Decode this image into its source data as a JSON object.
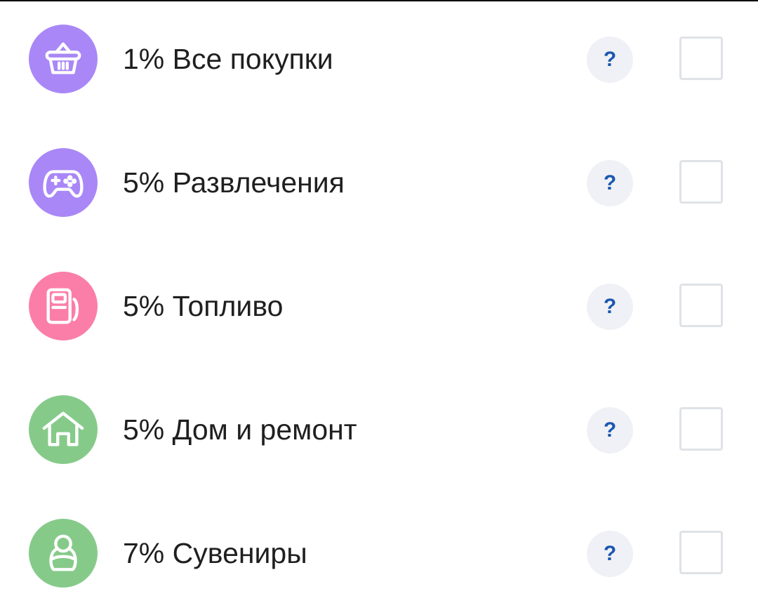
{
  "categories": [
    {
      "label": "1% Все покупки",
      "icon": "shopping-basket-icon",
      "color": "#a987f7",
      "help": "?",
      "checked": false
    },
    {
      "label": "5% Развлечения",
      "icon": "gamepad-icon",
      "color": "#a987f7",
      "help": "?",
      "checked": false
    },
    {
      "label": "5% Топливо",
      "icon": "fuel-pump-icon",
      "color": "#fb7ea8",
      "help": "?",
      "checked": false
    },
    {
      "label": "5% Дом и ремонт",
      "icon": "house-icon",
      "color": "#86ca8a",
      "help": "?",
      "checked": false
    },
    {
      "label": "7% Сувениры",
      "icon": "matryoshka-icon",
      "color": "#86ca8a",
      "help": "?",
      "checked": false
    }
  ]
}
